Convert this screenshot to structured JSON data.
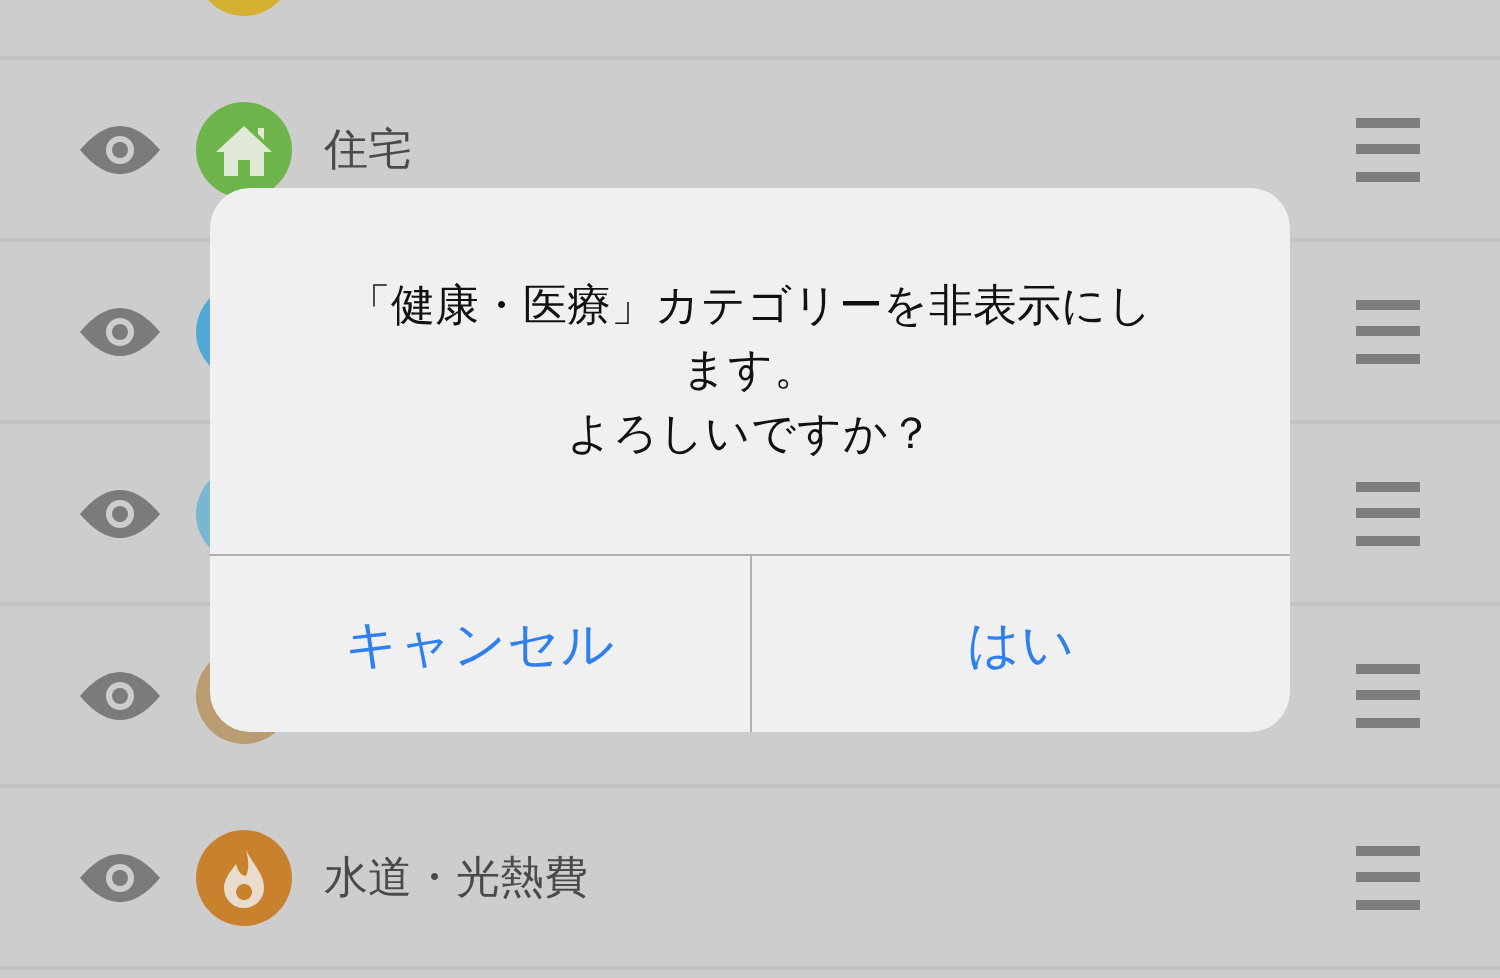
{
  "categories": [
    {
      "color": "#d4b030",
      "kind": "plain"
    },
    {
      "name": "住宅",
      "color": "#6db54a",
      "kind": "house"
    },
    {
      "color": "#52a9d6",
      "kind": "plain"
    },
    {
      "color": "#79b6cf",
      "kind": "plain"
    },
    {
      "color": "#b99c72",
      "kind": "plain"
    },
    {
      "name": "水道・光熱費",
      "color": "#c8822e",
      "kind": "flame"
    }
  ],
  "dialog": {
    "message": [
      "「健康・医療」カテゴリーを非表示にします。",
      "よろしいですか？"
    ],
    "buttons": [
      "キャンセル",
      "はい"
    ]
  }
}
